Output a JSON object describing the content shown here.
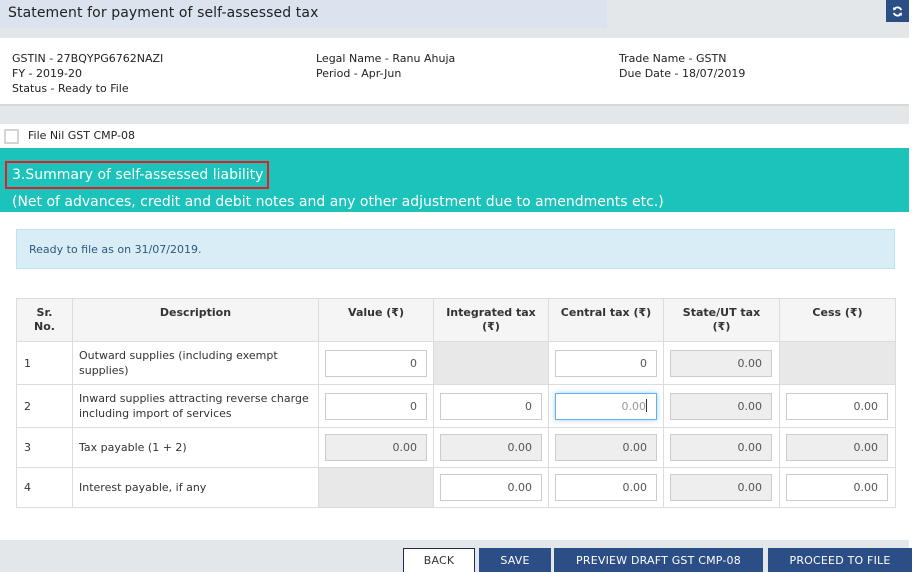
{
  "header": {
    "title": "Statement for payment of self-assessed tax",
    "refresh_icon": "refresh-icon"
  },
  "info": {
    "gstin": "GSTIN - 27BQYPG6762NAZI",
    "fy": "FY - 2019-20",
    "status": "Status - Ready to File",
    "legal_name": "Legal Name - Ranu Ahuja",
    "period": "Period - Apr-Jun",
    "trade_name": "Trade Name - GSTN",
    "due_date": "Due Date - 18/07/2019"
  },
  "nil_filing": {
    "label": "File Nil GST CMP-08",
    "checked": false
  },
  "section": {
    "title": "3.Summary of self-assessed liability",
    "subtitle": "(Net of advances, credit and debit notes and any other adjustment due to amendments etc.)"
  },
  "alert": {
    "text": "Ready to file as on 31/07/2019."
  },
  "table": {
    "headers": {
      "sr": "Sr. No.",
      "description": "Description",
      "value": "Value (₹)",
      "integrated": "Integrated tax (₹)",
      "central": "Central tax (₹)",
      "state": "State/UT tax (₹)",
      "cess": "Cess (₹)"
    },
    "rows": [
      {
        "sr": "1",
        "description": "Outward supplies (including exempt supplies)",
        "value": "0",
        "integrated": null,
        "central": "0",
        "state": "0.00",
        "cess": null
      },
      {
        "sr": "2",
        "description": "Inward supplies attracting reverse charge including import of services",
        "value": "0",
        "integrated": "0",
        "central_placeholder": "0.00",
        "state": "0.00",
        "cess": "0.00"
      },
      {
        "sr": "3",
        "description": "Tax payable (1 + 2)",
        "value": "0.00",
        "integrated": "0.00",
        "central": "0.00",
        "state": "0.00",
        "cess": "0.00"
      },
      {
        "sr": "4",
        "description": "Interest payable, if any",
        "value": null,
        "integrated": "0.00",
        "central": "0.00",
        "state": "0.00",
        "cess": "0.00"
      }
    ]
  },
  "footer": {
    "back_label": "BACK",
    "save_label": "SAVE",
    "preview_label": "PREVIEW DRAFT GST CMP-08",
    "proceed_label": "PROCEED TO FILE"
  },
  "colors": {
    "banner_teal": "#1bc3bb",
    "primary_navy": "#2c4e86",
    "highlight_red": "#e41e26",
    "alert_bg": "#d9edf7"
  }
}
